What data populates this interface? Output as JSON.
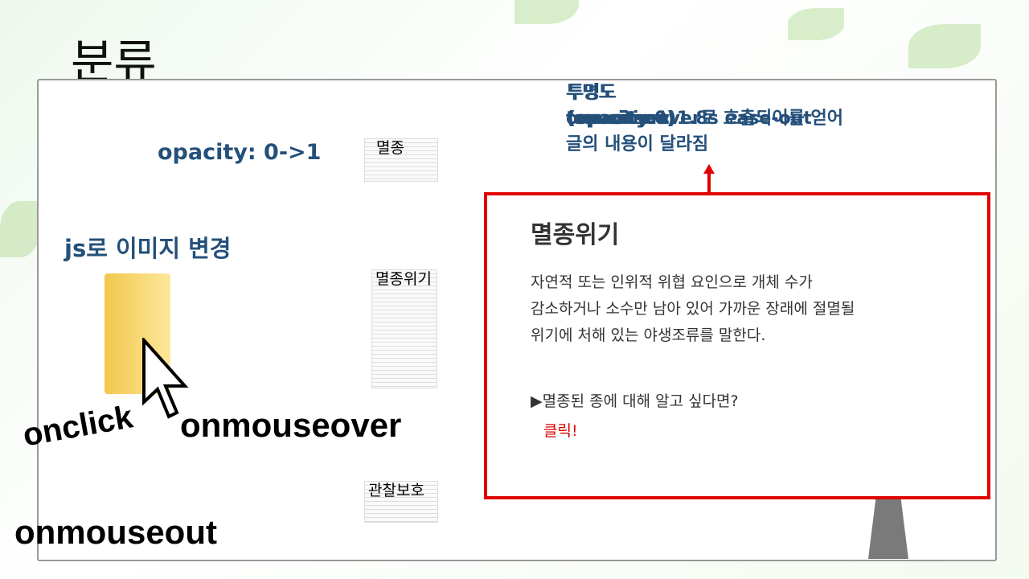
{
  "slide": {
    "title": "분류",
    "opacity_label": "opacity: 0->1",
    "js_label": "js로 이미지 변경",
    "events": {
      "onclick": "onclick",
      "onmouseover": "onmouseover",
      "onmouseout": "onmouseout"
    },
    "note": {
      "line1a": "투명도(opacity:0)",
      "line1b": "투명도(opacity:1)",
      "line2a": "transition: 1.8s ease-out",
      "line2b": "onmouseover로 호출되어를 얻어",
      "line3": "글의 내용이 달라짐"
    },
    "docs": [
      "멸종",
      "멸종위기",
      "관찰보호"
    ],
    "info": {
      "heading": "멸종위기",
      "body": "자연적 또는 인위적 위협 요인으로 개체 수가\n감소하거나 소수만 남아 있어 가까운 장래에 절멸될\n위기에 처해 있는 야생조류를 말한다.",
      "question": "▶멸종된 종에 대해 알고 싶다면?",
      "link": "클릭!"
    },
    "colors": {
      "accent": "#24507a",
      "highlight": "#e00000"
    }
  }
}
